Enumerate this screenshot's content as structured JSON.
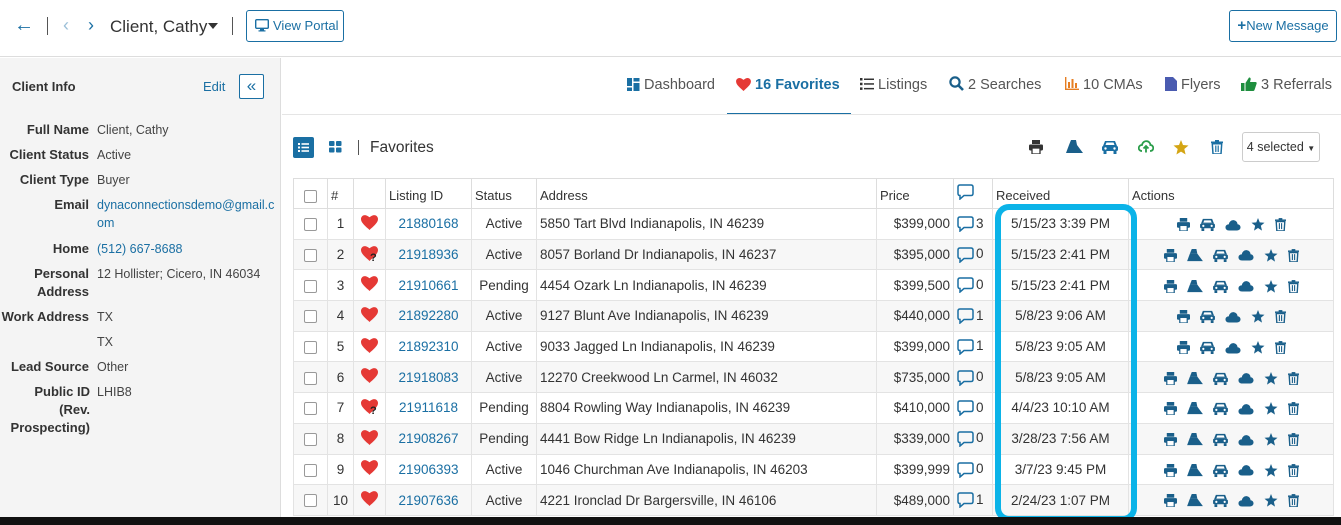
{
  "topbar": {
    "client_name": "Client, Cathy",
    "view_portal_label": "View Portal",
    "new_message_label": "New Message"
  },
  "sidebar": {
    "title": "Client Info",
    "edit_label": "Edit",
    "fields": [
      {
        "label": "Full Name",
        "value": "Client, Cathy"
      },
      {
        "label": "Client Status",
        "value": "Active"
      },
      {
        "label": "Client Type",
        "value": "Buyer"
      },
      {
        "label": "Email",
        "value": "dynaconnectionsdemo@gmail.com"
      },
      {
        "label": "Home",
        "value": "(512) 667-8688"
      },
      {
        "label": "Personal Address",
        "value": "12 Hollister; Cicero, IN 46034"
      },
      {
        "label": "Work Address",
        "value": "TX"
      },
      {
        "label": "",
        "value": "TX"
      },
      {
        "label": "Lead Source",
        "value": "Other"
      },
      {
        "label": "Public ID (Rev. Prospecting)",
        "value": "LHIB8"
      }
    ]
  },
  "nav": {
    "tabs": [
      {
        "label": "Dashboard"
      },
      {
        "label": "16 Favorites"
      },
      {
        "label": "Listings"
      },
      {
        "label": "2 Searches"
      },
      {
        "label": "10 CMAs"
      },
      {
        "label": "Flyers"
      },
      {
        "label": "3 Referrals"
      }
    ]
  },
  "favorites": {
    "title": "Favorites",
    "selected_label": "4 selected",
    "columns": [
      "#",
      "Listing ID",
      "Status",
      "Address",
      "Price",
      "Received",
      "Actions"
    ],
    "rows": [
      {
        "num": "1",
        "listing_id": "21880168",
        "status": "Active",
        "address": "5850 Tart Blvd Indianapolis, IN 46239",
        "price": "$399,000",
        "comments": "3",
        "received": "5/15/23 3:39 PM",
        "question": false,
        "actions": [
          "print",
          "car",
          "cloud",
          "star",
          "trash"
        ]
      },
      {
        "num": "2",
        "listing_id": "21918936",
        "status": "Active",
        "address": "8057 Borland Dr Indianapolis, IN 46237",
        "price": "$395,000",
        "comments": "0",
        "received": "5/15/23 2:41 PM",
        "question": true,
        "actions": [
          "print",
          "brief",
          "car",
          "cloud",
          "star",
          "trash"
        ]
      },
      {
        "num": "3",
        "listing_id": "21910661",
        "status": "Pending",
        "address": "4454 Ozark Ln Indianapolis, IN 46239",
        "price": "$399,500",
        "comments": "0",
        "received": "5/15/23 2:41 PM",
        "question": false,
        "actions": [
          "print",
          "brief",
          "car",
          "cloud",
          "star",
          "trash"
        ]
      },
      {
        "num": "4",
        "listing_id": "21892280",
        "status": "Active",
        "address": "9127 Blunt Ave Indianapolis, IN 46239",
        "price": "$440,000",
        "comments": "1",
        "received": "5/8/23 9:06 AM",
        "question": false,
        "actions": [
          "print",
          "car",
          "cloud",
          "star",
          "trash"
        ]
      },
      {
        "num": "5",
        "listing_id": "21892310",
        "status": "Active",
        "address": "9033 Jagged Ln Indianapolis, IN 46239",
        "price": "$399,000",
        "comments": "1",
        "received": "5/8/23 9:05 AM",
        "question": false,
        "actions": [
          "print",
          "car",
          "cloud",
          "star",
          "trash"
        ]
      },
      {
        "num": "6",
        "listing_id": "21918083",
        "status": "Active",
        "address": "12270 Creekwood Ln Carmel, IN 46032",
        "price": "$735,000",
        "comments": "0",
        "received": "5/8/23 9:05 AM",
        "question": false,
        "actions": [
          "print",
          "brief",
          "car",
          "cloud",
          "star",
          "trash"
        ]
      },
      {
        "num": "7",
        "listing_id": "21911618",
        "status": "Pending",
        "address": "8804 Rowling Way Indianapolis, IN 46239",
        "price": "$410,000",
        "comments": "0",
        "received": "4/4/23 10:10 AM",
        "question": true,
        "actions": [
          "print",
          "brief",
          "car",
          "cloud",
          "star",
          "trash"
        ]
      },
      {
        "num": "8",
        "listing_id": "21908267",
        "status": "Pending",
        "address": "4441 Bow Ridge Ln Indianapolis, IN 46239",
        "price": "$339,000",
        "comments": "0",
        "received": "3/28/23 7:56 AM",
        "question": false,
        "actions": [
          "print",
          "brief",
          "car",
          "cloud",
          "star",
          "trash"
        ]
      },
      {
        "num": "9",
        "listing_id": "21906393",
        "status": "Active",
        "address": "1046 Churchman Ave Indianapolis, IN 46203",
        "price": "$399,999",
        "comments": "0",
        "received": "3/7/23 9:45 PM",
        "question": false,
        "actions": [
          "print",
          "brief",
          "car",
          "cloud",
          "star",
          "trash"
        ]
      },
      {
        "num": "10",
        "listing_id": "21907636",
        "status": "Active",
        "address": "4221 Ironclad Dr Bargersville, IN 46106",
        "price": "$489,000",
        "comments": "1",
        "received": "2/24/23 1:07 PM",
        "question": false,
        "actions": [
          "print",
          "brief",
          "car",
          "cloud",
          "star",
          "trash"
        ]
      }
    ]
  },
  "colors": {
    "accent": "#1a6fa3",
    "heart": "#e53935",
    "highlight": "#0bb3e8",
    "star": "#d4a514",
    "cloud": "#2a9d4a"
  }
}
